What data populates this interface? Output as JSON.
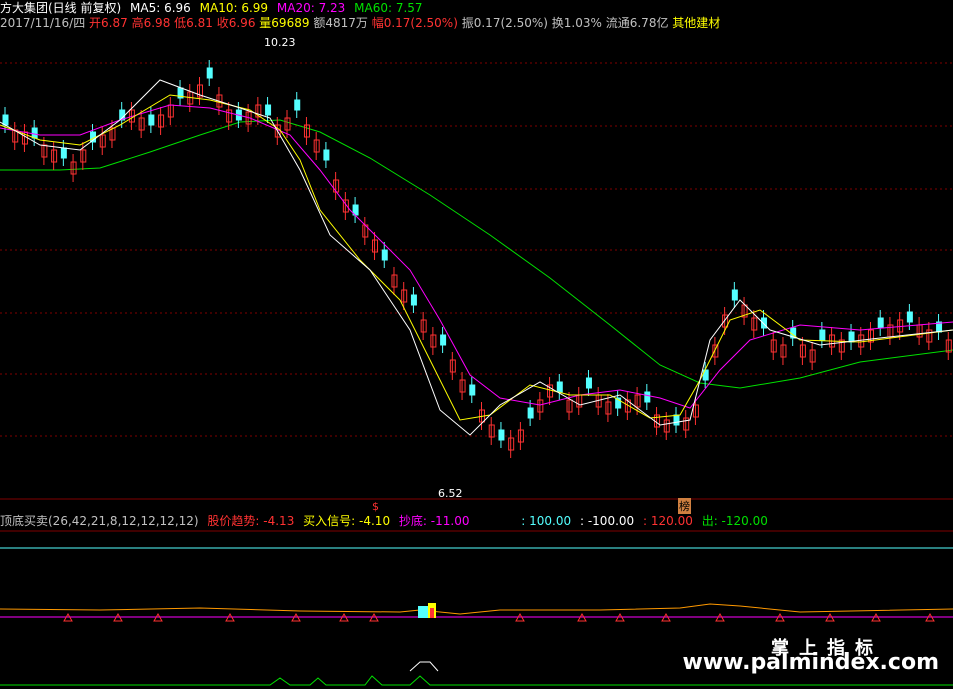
{
  "header": {
    "stock": "方大集团(日线 前复权)",
    "ma5_label": "MA5: 6.96",
    "ma10_label": "MA10: 6.99",
    "ma20_label": "MA20: 7.23",
    "ma60_label": "MA60: 7.57",
    "date": "2017/11/16/四",
    "open": "开6.87",
    "high": "高6.98",
    "low": "低6.81",
    "close": "收6.96",
    "volume": "量69689",
    "amount": "额4817万",
    "change": "幅0.17(2.50%)",
    "amplitude": "振0.17(2.50%)",
    "turnover": "换1.03%",
    "float": "流通6.78亿",
    "sector": "其他建材"
  },
  "annotations": {
    "high_label": "10.23",
    "low_label": "6.52",
    "marker_s": "$",
    "marker_bang": "榜"
  },
  "indicator": {
    "name": "顶底买卖(26,42,21,8,12,12,12,12)",
    "trend": "股价趋势: -4.13",
    "buy_signal": "买入信号: -4.10",
    "bottom": "抄底: -11.00",
    "v1": ": 100.00",
    "v2": ": -100.00",
    "v3": ": 120.00",
    "out": "出: -120.00"
  },
  "watermark": {
    "cn": "掌上指标",
    "url": "www.palmindex.com"
  },
  "colors": {
    "up": "#ff3232",
    "down": "#54ffff",
    "ma5": "#ffffff",
    "ma10": "#ffff00",
    "ma20": "#ff00ff",
    "ma60": "#00e000",
    "grid": "#800000"
  },
  "chart_data": {
    "type": "candlestick",
    "high_point": 10.23,
    "low_point": 6.52
  }
}
